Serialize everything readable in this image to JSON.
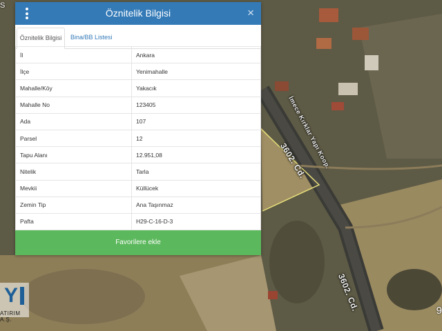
{
  "popup": {
    "title": "Öznitelik Bilgisi",
    "menu_icon": "vertical-dots-icon",
    "close_icon": "close-icon",
    "close_glyph": "×",
    "tabs": [
      {
        "label": "Öznitelik Bilgisi",
        "active": true
      },
      {
        "label": "Bina/BB Listesi",
        "active": false
      }
    ],
    "rows": [
      {
        "key": "İl",
        "value": "Ankara"
      },
      {
        "key": "İlçe",
        "value": "Yenimahalle"
      },
      {
        "key": "Mahalle/Köy",
        "value": "Yakacık"
      },
      {
        "key": "Mahalle No",
        "value": "123405"
      },
      {
        "key": "Ada",
        "value": "107"
      },
      {
        "key": "Parsel",
        "value": "12"
      },
      {
        "key": "Tapu Alanı",
        "value": "12.951,08"
      },
      {
        "key": "Nitelik",
        "value": "Tarla"
      },
      {
        "key": "Mevkii",
        "value": "Küllücek"
      },
      {
        "key": "Zemin Tip",
        "value": "Ana Taşınmaz"
      },
      {
        "key": "Pafta",
        "value": "H29-C-16-D-3"
      }
    ],
    "favorite_button": "Favorilere ekle"
  },
  "map": {
    "road_labels": [
      "3602. Cd.",
      "3602. Cd.",
      "İmece Kırklar Yapı Koop."
    ],
    "edge_left_text": "S",
    "edge_right_text": "9"
  },
  "logo": {
    "mark": "Y",
    "subtext": "ATIRIM A.Ş."
  },
  "colors": {
    "header_blue": "#337ab7",
    "button_green": "#5cb85c",
    "parcel_outline": "#e8e07a"
  }
}
